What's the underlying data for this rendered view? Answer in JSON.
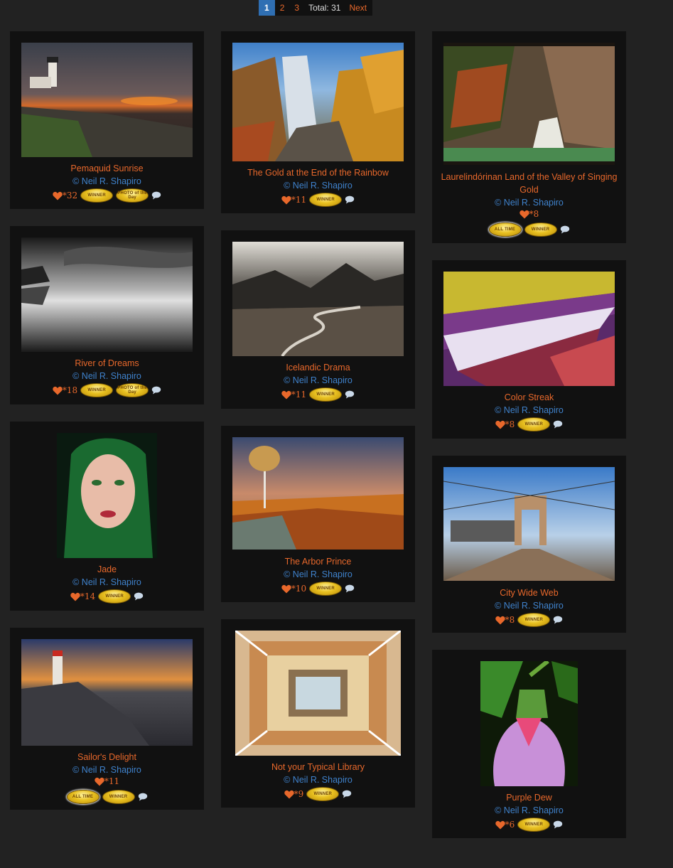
{
  "pagination": {
    "pages": [
      "1",
      "2",
      "3"
    ],
    "current": "1",
    "total_label": "Total: 31",
    "next_label": "Next"
  },
  "colors": {
    "accent": "#e8682b",
    "link": "#3f82cc",
    "card_bg": "#111111",
    "page_bg": "#222222"
  },
  "cards": [
    {
      "title": "Pemaquid Sunrise",
      "author": "© Neil R. Shapiro",
      "likes": "*32",
      "badges": [
        "WINNER",
        "PHOTO of the Day"
      ]
    },
    {
      "title": "The Gold at the End of the Rainbow",
      "author": "© Neil R. Shapiro",
      "likes": "*11",
      "badges": [
        "WINNER"
      ]
    },
    {
      "title": "Laurelindórinan Land of the Valley of Singing Gold",
      "author": "© Neil R. Shapiro",
      "likes": "*8",
      "badges": [
        "ALL TIME",
        "WINNER"
      ]
    },
    {
      "title": "River of Dreams",
      "author": "© Neil R. Shapiro",
      "likes": "*18",
      "badges": [
        "WINNER",
        "PHOTO of the Day"
      ]
    },
    {
      "title": "Icelandic Drama",
      "author": "© Neil R. Shapiro",
      "likes": "*11",
      "badges": [
        "WINNER"
      ]
    },
    {
      "title": "Color Streak",
      "author": "© Neil R. Shapiro",
      "likes": "*8",
      "badges": [
        "WINNER"
      ]
    },
    {
      "title": "Jade",
      "author": "© Neil R. Shapiro",
      "likes": "*14",
      "badges": [
        "WINNER"
      ]
    },
    {
      "title": "The Arbor Prince",
      "author": "© Neil R. Shapiro",
      "likes": "*10",
      "badges": [
        "WINNER"
      ]
    },
    {
      "title": "City Wide Web",
      "author": "© Neil R. Shapiro",
      "likes": "*8",
      "badges": [
        "WINNER"
      ]
    },
    {
      "title": "Sailor's Delight",
      "author": "© Neil R. Shapiro",
      "likes": "*11",
      "badges": [
        "ALL TIME",
        "WINNER"
      ]
    },
    {
      "title": "Not your Typical Library",
      "author": "© Neil R. Shapiro",
      "likes": "*9",
      "badges": [
        "WINNER"
      ]
    },
    {
      "title": "Purple Dew",
      "author": "© Neil R. Shapiro",
      "likes": "*6",
      "badges": [
        "WINNER"
      ]
    }
  ]
}
